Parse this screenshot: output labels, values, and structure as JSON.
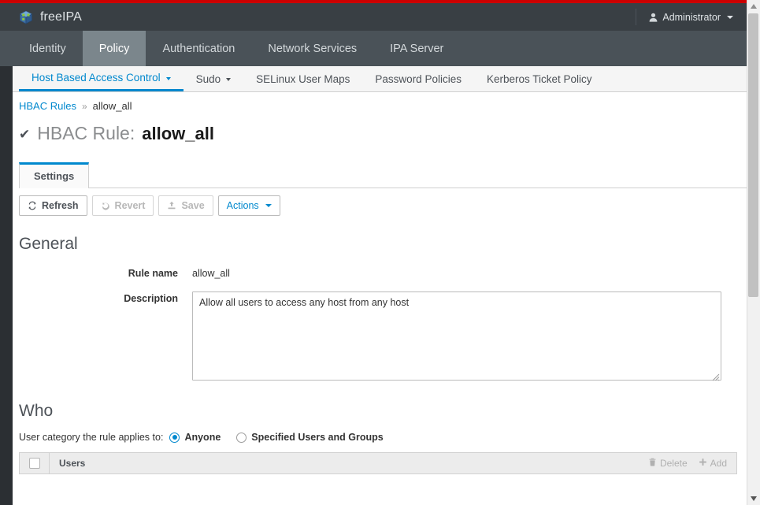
{
  "brand": {
    "name": "freeIPA",
    "logo_icon": "cube-icon",
    "accent_color": "#cc0000",
    "masthead_bg": "#393f44"
  },
  "user_menu": {
    "label": "Administrator",
    "icon": "user-icon",
    "caret_icon": "chevron-down-icon"
  },
  "primary_nav": {
    "active": "Policy",
    "items": [
      {
        "label": "Identity"
      },
      {
        "label": "Policy"
      },
      {
        "label": "Authentication"
      },
      {
        "label": "Network Services"
      },
      {
        "label": "IPA Server"
      }
    ]
  },
  "secondary_nav": {
    "active": "Host Based Access Control",
    "active_color": "#0088ce",
    "items": [
      {
        "label": "Host Based Access Control",
        "has_caret": true
      },
      {
        "label": "Sudo",
        "has_caret": true
      },
      {
        "label": "SELinux User Maps",
        "has_caret": false
      },
      {
        "label": "Password Policies",
        "has_caret": false
      },
      {
        "label": "Kerberos Ticket Policy",
        "has_caret": false
      }
    ]
  },
  "breadcrumb": {
    "root": "HBAC Rules",
    "separator": "»",
    "current": "allow_all"
  },
  "page_title": {
    "check_icon": "check-icon",
    "prefix": "HBAC Rule:",
    "object": "allow_all"
  },
  "facet_tabs": [
    {
      "label": "Settings",
      "active": true
    }
  ],
  "toolbar": {
    "refresh_label": "Refresh",
    "refresh_icon": "refresh-icon",
    "revert_label": "Revert",
    "revert_icon": "undo-icon",
    "revert_disabled": true,
    "save_label": "Save",
    "save_icon": "save-upload-icon",
    "save_disabled": true,
    "actions_label": "Actions",
    "actions_caret_icon": "chevron-down-icon"
  },
  "general": {
    "heading": "General",
    "rule_name_label": "Rule name",
    "rule_name_value": "allow_all",
    "description_label": "Description",
    "description_value": "Allow all users to access any host from any host",
    "description_placeholder": ""
  },
  "who": {
    "heading": "Who",
    "category_label": "User category the rule applies to:",
    "options": [
      {
        "label": "Anyone",
        "checked": true
      },
      {
        "label": "Specified Users and Groups",
        "checked": false
      }
    ],
    "table": {
      "select_all_checkbox": "select-all",
      "column_header": "Users",
      "delete_label": "Delete",
      "delete_icon": "trash-icon",
      "delete_disabled": true,
      "add_label": "Add",
      "add_icon": "plus-icon",
      "add_disabled": true,
      "rows": []
    }
  },
  "scrollbar": {
    "up_icon": "triangle-up-icon",
    "down_icon": "triangle-down-icon"
  }
}
